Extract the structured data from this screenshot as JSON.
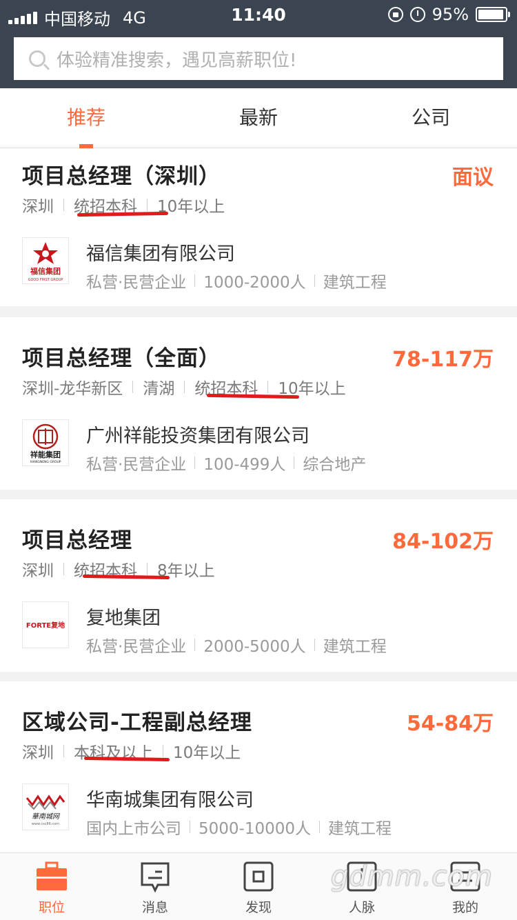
{
  "status_bar": {
    "carrier": "中国移动",
    "network": "4G",
    "time": "11:40",
    "battery": "95%",
    "battery_level": 0.95
  },
  "search": {
    "placeholder": "体验精准搜索，遇见高薪职位!"
  },
  "tabs": [
    {
      "label": "推荐",
      "active": true
    },
    {
      "label": "最新",
      "active": false
    },
    {
      "label": "公司",
      "active": false
    }
  ],
  "jobs": [
    {
      "title": "项目总经理（深圳）",
      "salary": "面议",
      "meta": [
        "深圳",
        "统招本科",
        "10年以上"
      ],
      "company": "福信集团有限公司",
      "company_info": [
        "私营·民营企业",
        "1000-2000人",
        "建筑工程"
      ],
      "logo_text": "福信集团",
      "logo_sub": "GOOD FIRST GROUP"
    },
    {
      "title": "项目总经理（全面）",
      "salary": "78-117万",
      "meta": [
        "深圳-龙华新区",
        "清湖",
        "统招本科",
        "10年以上"
      ],
      "company": "广州祥能投资集团有限公司",
      "company_info": [
        "私营·民营企业",
        "100-499人",
        "综合地产"
      ],
      "logo_text": "祥能集团",
      "logo_sub": "XIANGNENG GROUP"
    },
    {
      "title": "项目总经理",
      "salary": "84-102万",
      "meta": [
        "深圳",
        "统招本科",
        "8年以上"
      ],
      "company": "复地集团",
      "company_info": [
        "私营·民营企业",
        "2000-5000人",
        "建筑工程"
      ],
      "logo_text": "FORTE复地"
    },
    {
      "title": "区域公司-工程副总经理",
      "salary": "54-84万",
      "meta": [
        "深圳",
        "本科及以上",
        "10年以上"
      ],
      "company": "华南城集团有限公司",
      "company_info": [
        "国内上市公司",
        "5000-10000人",
        "建筑工程"
      ],
      "logo_text": "華南城网",
      "logo_sub": "www.csc86.com"
    }
  ],
  "bottom_nav": [
    {
      "label": "职位",
      "icon": "briefcase-icon",
      "active": true
    },
    {
      "label": "消息",
      "icon": "message-icon",
      "active": false
    },
    {
      "label": "发现",
      "icon": "discover-icon",
      "active": false
    },
    {
      "label": "人脉",
      "icon": "contacts-icon",
      "active": false
    },
    {
      "label": "我的",
      "icon": "profile-icon",
      "active": false
    }
  ],
  "watermark": "gdmm.com",
  "colors": {
    "accent": "#ff6a3c",
    "header": "#3b4451",
    "annotation": "#e01b1b"
  }
}
